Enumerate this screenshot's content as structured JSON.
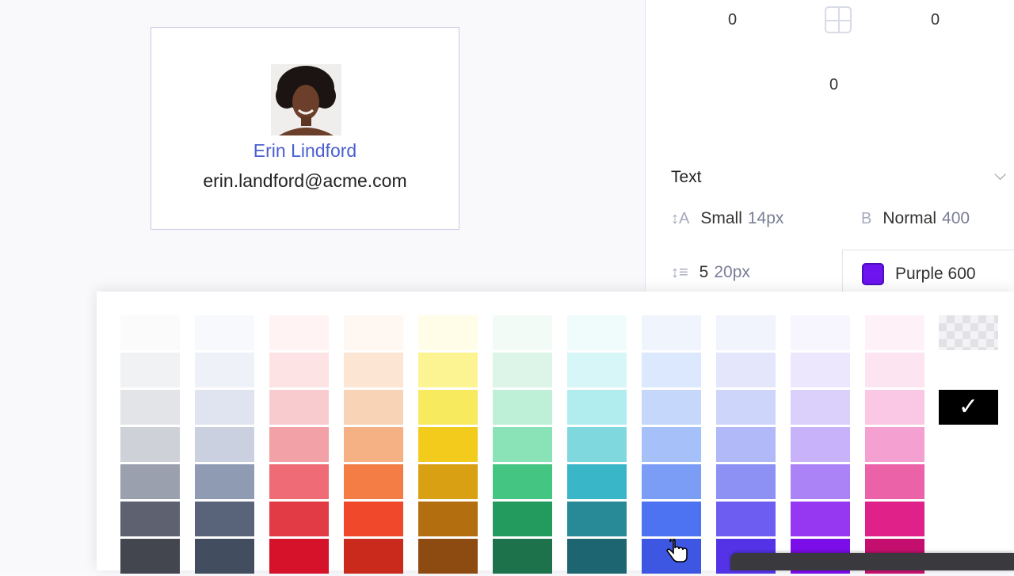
{
  "card": {
    "name": "Erin Lindford",
    "email": "erin.landford@acme.com"
  },
  "spacing": {
    "top_left": "0",
    "top_right": "0",
    "bottom": "0"
  },
  "text_section": {
    "title": "Text",
    "font_size": {
      "icon": "↕A",
      "label": "Small",
      "value": "14px"
    },
    "font_weight": {
      "icon": "B",
      "label": "Normal",
      "value": "400"
    },
    "line_height": {
      "icon": "↕≡",
      "label": "5",
      "value": "20px"
    },
    "color": {
      "label": "Purple 600",
      "swatch": "#6d14ef"
    }
  },
  "palette": [
    [
      "#fbfbfc",
      "#f1f2f4",
      "#e3e4e8",
      "#ced1d8",
      "#9aa0ae",
      "#5d6170",
      "#43464f"
    ],
    [
      "#f8f9fc",
      "#eef1f8",
      "#e0e4f0",
      "#cad0e0",
      "#8f9ab3",
      "#596379",
      "#434d60"
    ],
    [
      "#fff3f3",
      "#fde3e3",
      "#f8cbcf",
      "#f2a1a6",
      "#ef6b76",
      "#e33b46",
      "#d5122a"
    ],
    [
      "#fff7f1",
      "#fde5d3",
      "#f9d3b5",
      "#f5b183",
      "#f37d45",
      "#f0482a",
      "#c92a1c"
    ],
    [
      "#fffde7",
      "#fcf493",
      "#f7ea5e",
      "#f2cb1c",
      "#d9a014",
      "#b36e10",
      "#8d4b12"
    ],
    [
      "#f3fbf6",
      "#dcf5e8",
      "#bdf0d7",
      "#8ae3b6",
      "#44c582",
      "#239a5e",
      "#1d714b"
    ],
    [
      "#f0fcfc",
      "#d6f6f7",
      "#b1edee",
      "#7fd8de",
      "#39b6c7",
      "#288997",
      "#1d6671"
    ],
    [
      "#eff4fd",
      "#dce8fd",
      "#c5d7fb",
      "#a6c0fa",
      "#7b9df6",
      "#4e73f2",
      "#3d57e3"
    ],
    [
      "#f1f3fd",
      "#e4e7fc",
      "#ced5fb",
      "#b1b9f8",
      "#8c91f3",
      "#6d5df0",
      "#5433e6"
    ],
    [
      "#f7f5fe",
      "#ece7fd",
      "#dbcffb",
      "#c8b2fa",
      "#ac83f6",
      "#9638f1",
      "#7b0de8"
    ],
    [
      "#fff1f8",
      "#fde4f1",
      "#fac7e5",
      "#f4a0d1",
      "#eb62a9",
      "#e0218a",
      "#c50f6e"
    ]
  ],
  "picker": {
    "selected_check": "✓",
    "transparent_swatch": "transparent"
  },
  "icons": {
    "padding_icon": "box-model-icon",
    "chevron": "chevron-down-icon",
    "cursor": "pointer-hand-icon"
  }
}
